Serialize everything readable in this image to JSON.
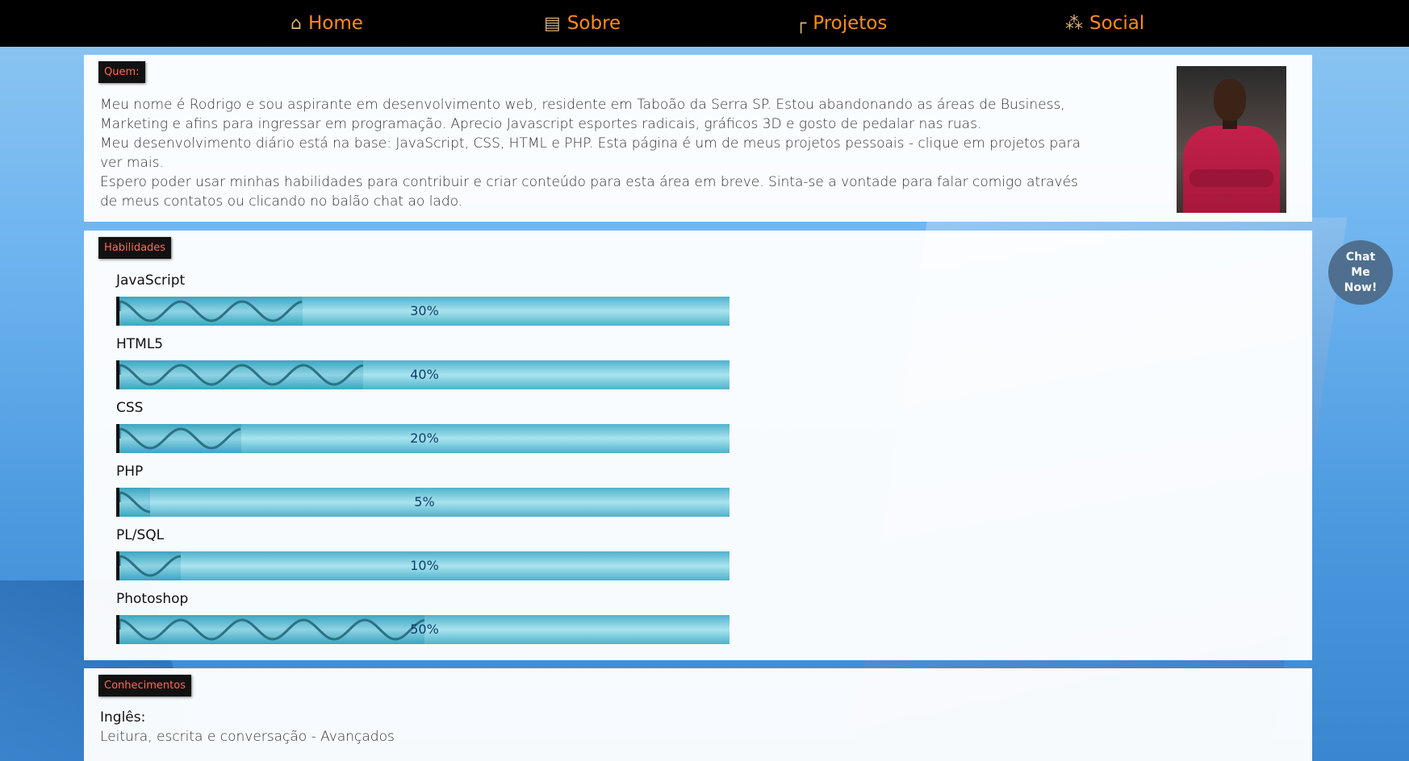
{
  "nav": {
    "items": [
      {
        "label": "Home",
        "icon": "house-icon"
      },
      {
        "label": "Sobre",
        "icon": "document-icon"
      },
      {
        "label": "Projetos",
        "icon": "crane-icon"
      },
      {
        "label": "Social",
        "icon": "person-icon"
      }
    ]
  },
  "about": {
    "tag": "Quem:",
    "lines": [
      "Meu nome é Rodrigo e sou aspirante em desenvolvimento web, residente em Taboão da Serra SP. Estou abandonando as áreas de Business, Marketing e afins para ingressar em programação. Aprecio Javascript esportes radicais, gráficos 3D e gosto de pedalar nas ruas.",
      "Meu desenvolvimento diário está na base: JavaScript, CSS, HTML e PHP. Esta página é um de meus projetos pessoais - clique em projetos para ver mais.",
      "Espero poder usar minhas habilidades para contribuir e criar conteúdo para esta área em breve. Sinta-se a vontade para falar comigo através de meus contatos ou clicando no balão chat ao lado."
    ]
  },
  "skills": {
    "tag": "Habilidades",
    "items": [
      {
        "label": "JavaScript",
        "pct_text": "30%",
        "level": 0.3
      },
      {
        "label": "HTML5",
        "pct_text": "40%",
        "level": 0.4
      },
      {
        "label": "CSS",
        "pct_text": "20%",
        "level": 0.2
      },
      {
        "label": "PHP",
        "pct_text": "5%",
        "level": 0.05
      },
      {
        "label": "PL/SQL",
        "pct_text": "10%",
        "level": 0.1
      },
      {
        "label": "Photoshop",
        "pct_text": "50%",
        "level": 0.5
      }
    ]
  },
  "knowledge": {
    "tag": "Conhecimentos",
    "title": "Inglês:",
    "desc": "Leitura, escrita e conversação - Avançados"
  },
  "chat": {
    "lines": [
      "Chat",
      "Me",
      "Now!"
    ]
  },
  "colors": {
    "nav_bg": "#000000",
    "nav_text": "#ff8c1a",
    "tag_text": "#ff6a52",
    "chat_bg": "#4e6f8f"
  }
}
